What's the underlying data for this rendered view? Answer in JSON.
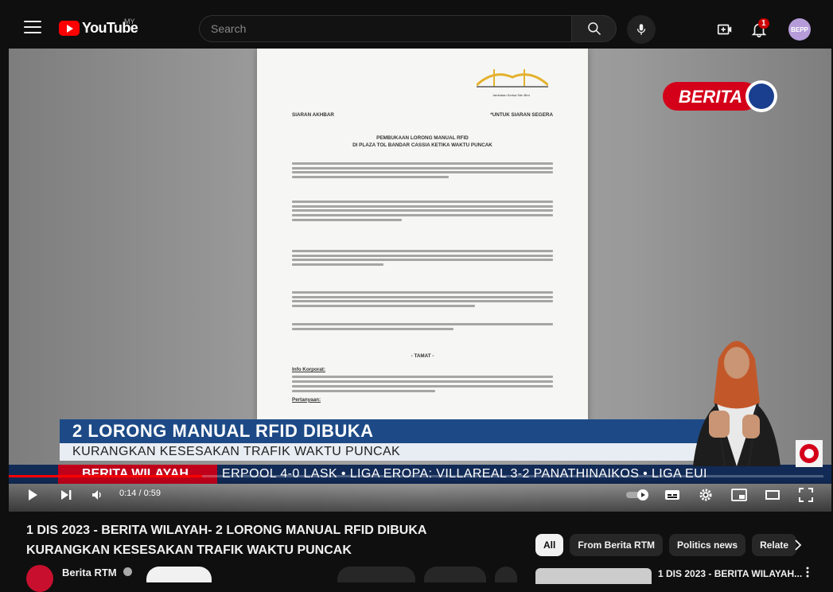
{
  "header": {
    "logo_text": "YouTube",
    "region": "MY",
    "search_placeholder": "Search",
    "notification_count": "1",
    "avatar_initials": "BEPP"
  },
  "video": {
    "doc": {
      "company": "Jambatan Kedua Sdn Bhd",
      "left_header": "SIARAN AKHBAR",
      "right_header": "*UNTUK SIARAN SEGERA",
      "title_line1": "PEMBUKAAN LORONG MANUAL RFID",
      "title_line2": "DI PLAZA TOL BANDAR CASSIA KETIKA WAKTU PUNCAK",
      "tamat": "- TAMAT -",
      "info_heading": "Info Korporat:",
      "pertanyaan": "Pertanyaan:"
    },
    "brand": "BERITA",
    "lower_third_headline": "2 LORONG MANUAL RFID DIBUKA",
    "lower_third_sub": "KURANGKAN KESESAKAN TRAFIK WAKTU PUNCAK",
    "ticker_label": "BERITA WILAYAH",
    "ticker_text": "ERPOOL 4-0 LASK   •   LIGA EROPA: VILLAREAL 3-2 PANATHINAIKOS   •   LIGA EUI",
    "current_time": "0:14",
    "duration": "0:59",
    "time_display": "0:14 / 0:59",
    "progress_fraction": 0.237
  },
  "title_line1": "1 DIS 2023 - BERITA WILAYAH- 2 LORONG MANUAL RFID DIBUKA",
  "title_line2": "KURANGKAN KESESAKAN TRAFIK WAKTU PUNCAK",
  "channel": {
    "name": "Berita RTM"
  },
  "chips": [
    "All",
    "From Berita RTM",
    "Politics news",
    "Relate"
  ],
  "recommendation": {
    "title": "1 DIS 2023 - BERITA WILAYAH..."
  },
  "colors": {
    "accent": "#ff0000",
    "background": "#0f0f0f",
    "chip_bg": "#272727",
    "lower_third_blue": "#1d4a86",
    "ticker_red": "#c0001a"
  },
  "icons": [
    "menu-icon",
    "youtube-logo-icon",
    "search-icon",
    "mic-icon",
    "create-icon",
    "bell-icon",
    "play-icon",
    "next-icon",
    "volume-icon",
    "autoplay-toggle-icon",
    "subtitles-icon",
    "settings-icon",
    "miniplayer-icon",
    "theater-icon",
    "fullscreen-icon",
    "chevron-right-icon",
    "verified-icon",
    "more-vert-icon"
  ]
}
